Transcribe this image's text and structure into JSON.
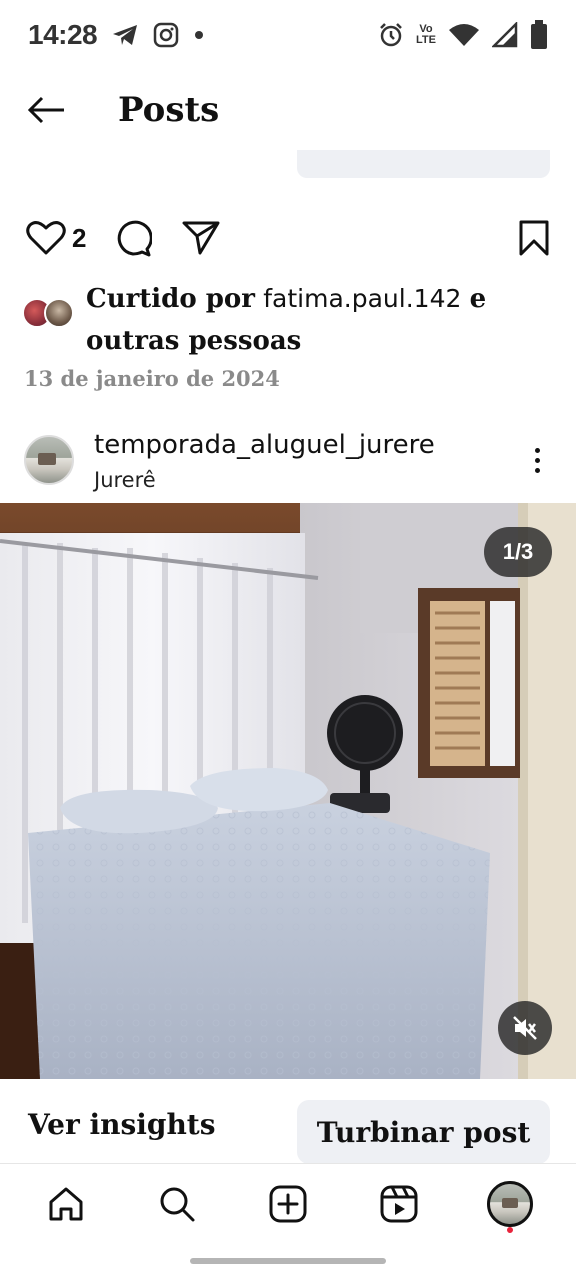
{
  "status_bar": {
    "time": "14:28",
    "left_icons": [
      "telegram-icon",
      "instagram-icon",
      "dot-icon"
    ],
    "right_icons": [
      "alarm-icon",
      "volte-icon",
      "wifi-icon",
      "signal-icon",
      "battery-icon"
    ],
    "volte_line1": "Vo",
    "volte_line2": "LTE"
  },
  "header": {
    "title": "Posts",
    "back_icon": "arrow-left-icon"
  },
  "post": {
    "like_count": "2",
    "likes_prefix": "Curtido por",
    "likes_user": "fatima.paul.142",
    "likes_suffix_1": "e",
    "likes_suffix_2": "outras pessoas",
    "date": "13 de janeiro de 2024",
    "username": "temporada_aluguel_jurere",
    "location": "Jurerê",
    "media_counter": "1/3",
    "actions": {
      "insights_label": "Ver insights",
      "boost_label": "Turbinar post"
    }
  },
  "bottom_nav": {
    "items": [
      "home-icon",
      "search-icon",
      "create-icon",
      "reels-icon",
      "profile-avatar"
    ]
  },
  "colors": {
    "accent_red": "#e8243c",
    "boost_bg": "#eef0f4",
    "muted_text": "#8a8a8a"
  }
}
